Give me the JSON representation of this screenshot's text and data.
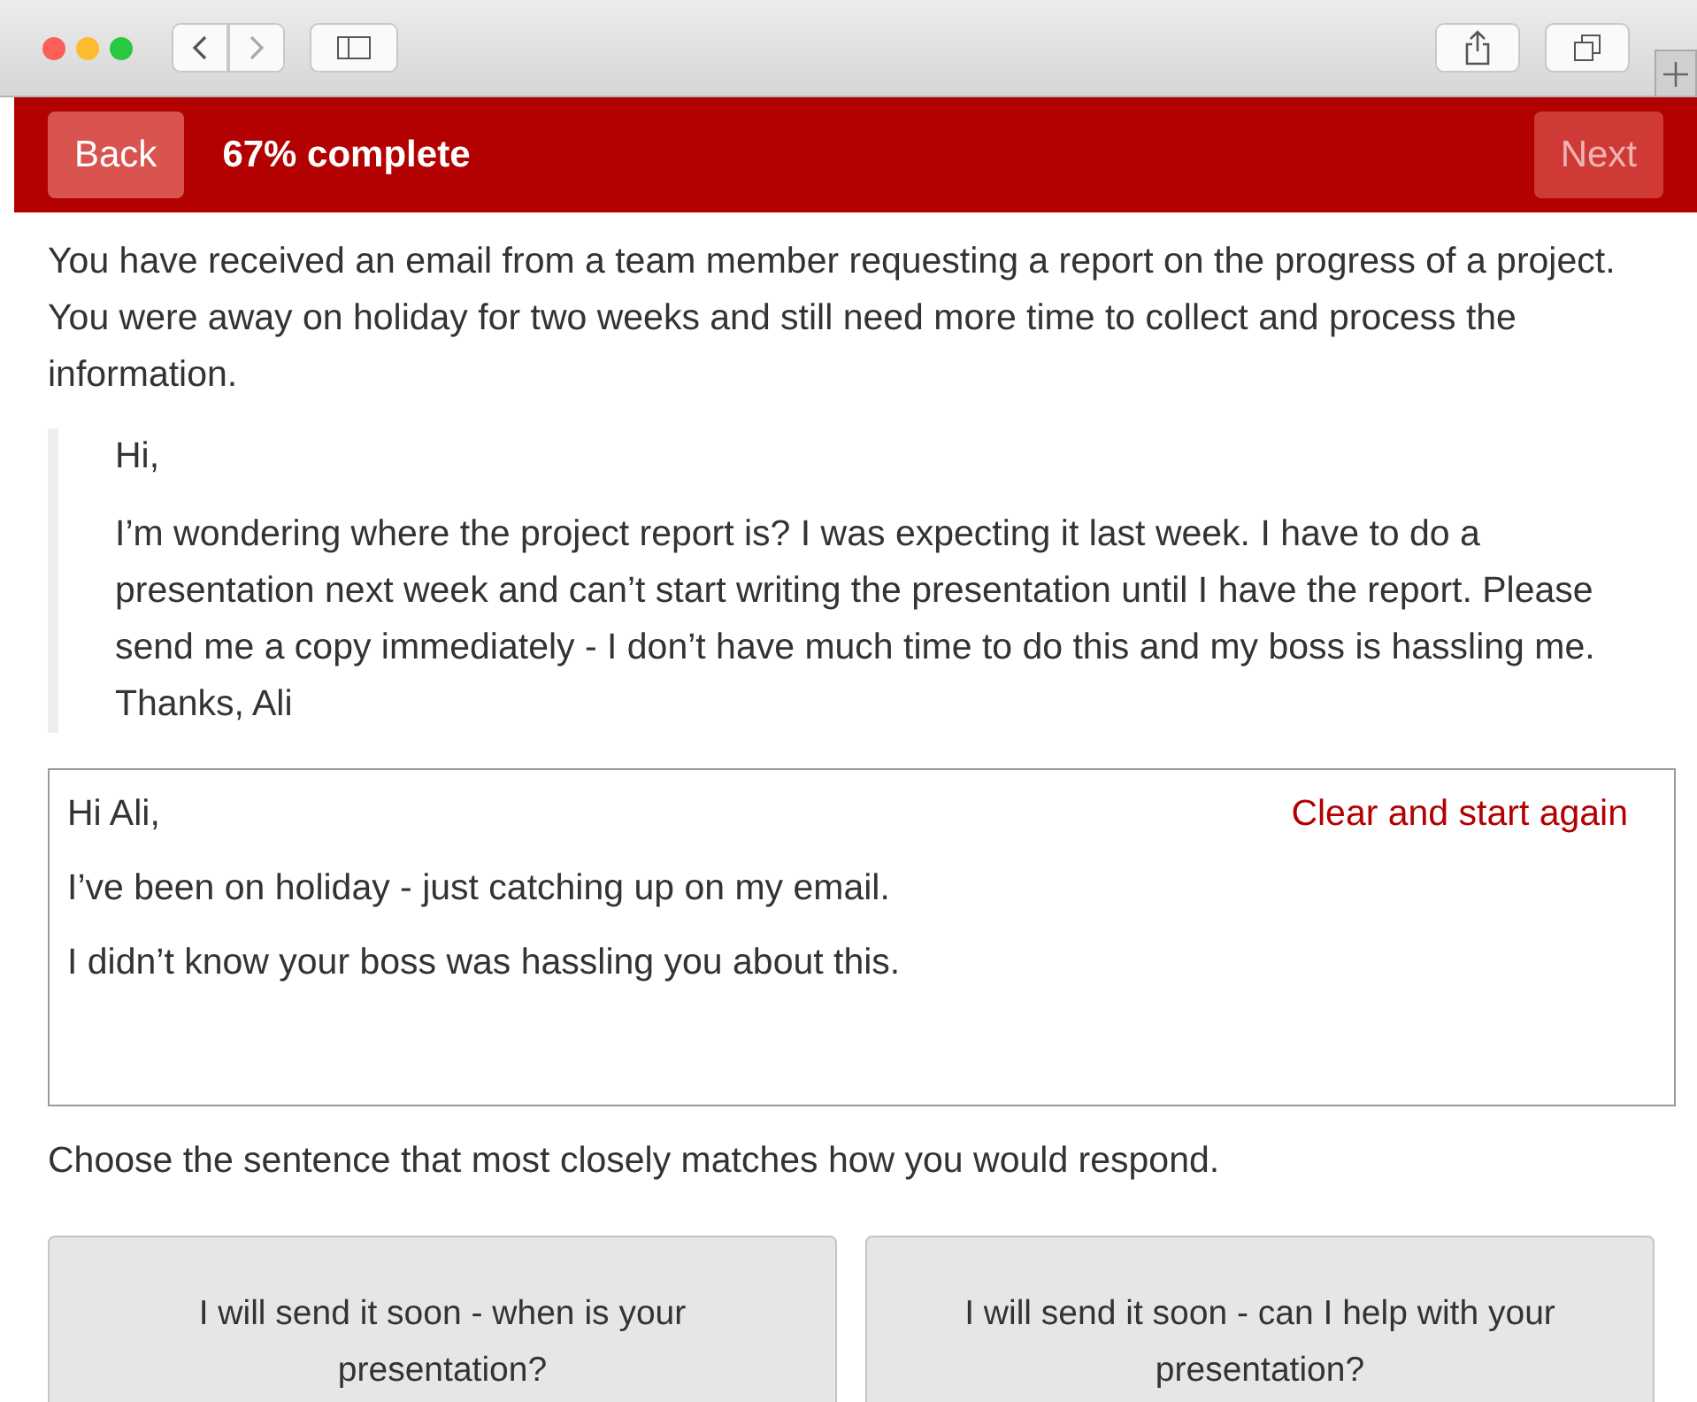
{
  "header": {
    "back": {
      "label": "Back",
      "disabled": false
    },
    "status": "67% complete",
    "next": {
      "label": "Next",
      "disabled": true
    }
  },
  "intro": "You have received an email from a team member requesting a report on the progress of a project. You were away on holiday for two weeks and still need more time to collect and process the information.",
  "email": {
    "paragraphs": [
      "Hi,",
      "I’m wondering where the project report is? I was expecting it last week. I have to do a presentation next week and can’t start writing the presentation until I have the report. Please send me a copy immediately - I don’t have much time to do this and my boss is hassling me. Thanks, Ali"
    ]
  },
  "reply": {
    "lines": [
      "Hi Ali,",
      "I’ve been on holiday - just catching up on my email.",
      "I didn’t know your boss was hassling you about this."
    ],
    "clear_link": "Clear and start again"
  },
  "prompt": "Choose the sentence that most closely matches how you would respond.",
  "options": [
    {
      "label": "I will send it soon - when is your presentation?"
    },
    {
      "label": "I will send it soon - can I help with your presentation?"
    }
  ]
}
